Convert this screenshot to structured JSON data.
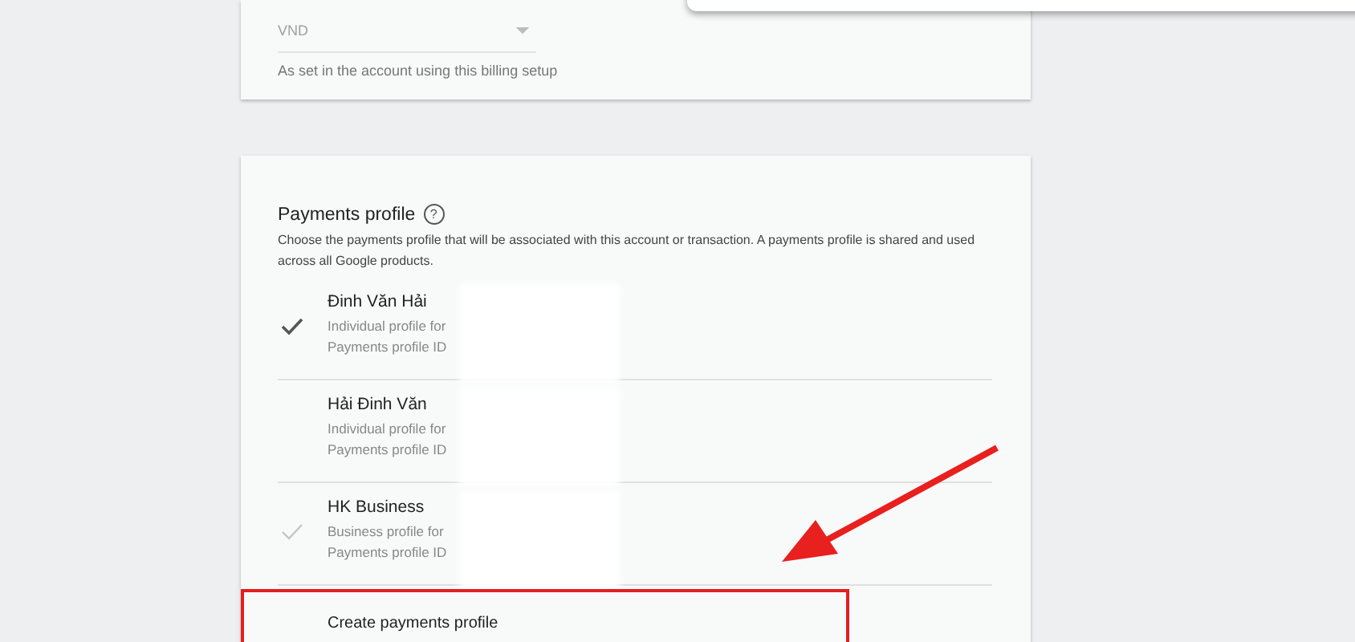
{
  "currency": {
    "value": "VND",
    "hint": "As set in the account using this billing setup"
  },
  "payments_profile": {
    "title": "Payments profile",
    "help_icon": "?",
    "description": "Choose the payments profile that will be associated with this account or transaction. A payments profile is shared and used across all Google products.",
    "profiles": [
      {
        "name": "Đinh Văn Hải",
        "type_line": "Individual profile for",
        "id_line": "Payments profile ID",
        "kind": "checked"
      },
      {
        "name": "Hải Đinh Văn",
        "type_line": "Individual profile for",
        "id_line": "Payments profile ID",
        "kind": "plain"
      },
      {
        "name": "HK Business",
        "type_line": "Business profile for",
        "id_line": "Payments profile ID",
        "kind": "faded"
      }
    ],
    "create_label": "Create payments profile"
  }
}
